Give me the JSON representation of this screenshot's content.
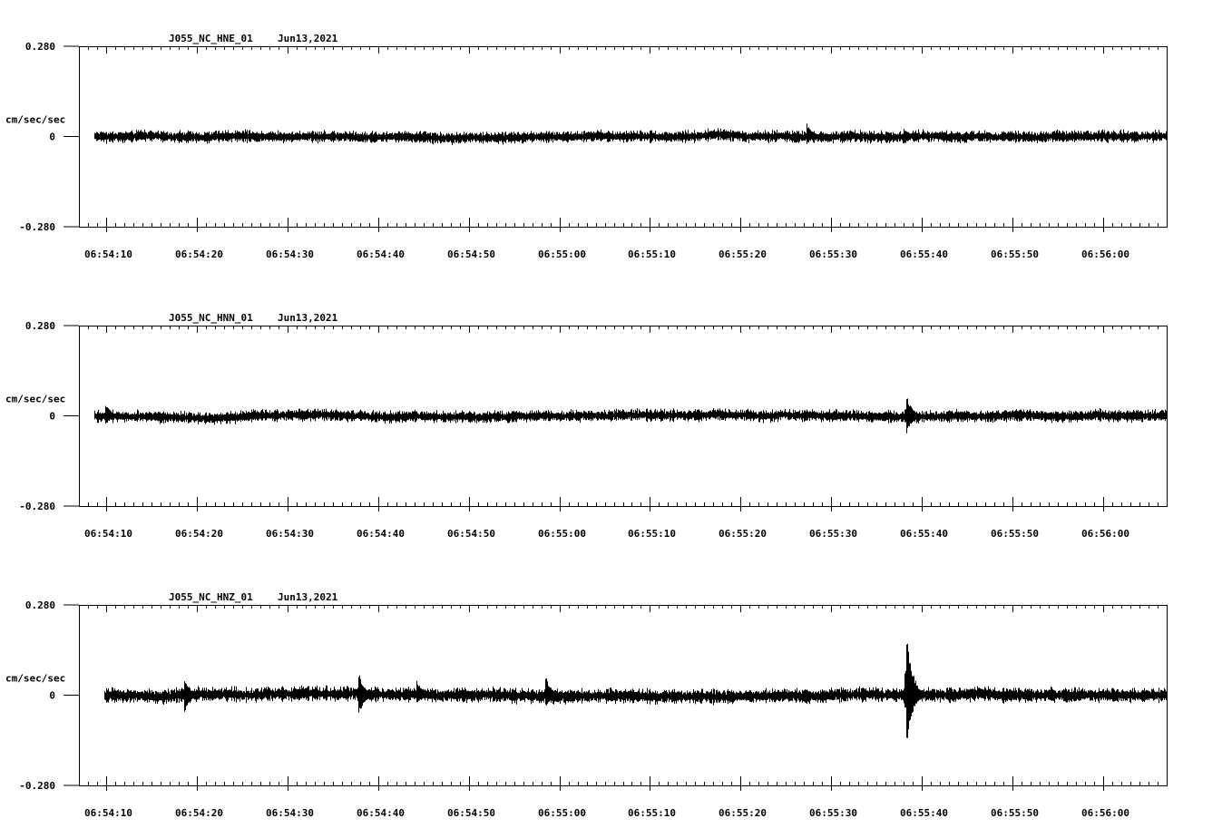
{
  "chart_data": [
    {
      "type": "line",
      "title": "J055_NC_HNE_01",
      "date": "Jun13,2021",
      "ylabel": "cm/sec/sec",
      "ylim": [
        -0.28,
        0.28
      ],
      "y_ticks": [
        "0.280",
        "0",
        "-0.280"
      ],
      "x_ticks": [
        "06:54:10",
        "06:54:20",
        "06:54:30",
        "06:54:40",
        "06:54:50",
        "06:55:00",
        "06:55:10",
        "06:55:20",
        "06:55:30",
        "06:55:40",
        "06:55:50",
        "06:56:00"
      ],
      "x_range_s": [
        7,
        127
      ],
      "signal": {
        "start_s": 8.7,
        "noise_amplitude": 0.018,
        "events": [
          {
            "t": 87.2,
            "peak_pos": 0.045,
            "peak_neg": -0.03
          },
          {
            "t": 97.9,
            "peak_pos": 0.03,
            "peak_neg": -0.03
          }
        ]
      },
      "grid": false,
      "color": "#000000"
    },
    {
      "type": "line",
      "title": "J055_NC_HNN_01",
      "date": "Jun13,2021",
      "ylabel": "cm/sec/sec",
      "ylim": [
        -0.28,
        0.28
      ],
      "y_ticks": [
        "0.280",
        "0",
        "-0.280"
      ],
      "x_ticks": [
        "06:54:10",
        "06:54:20",
        "06:54:30",
        "06:54:40",
        "06:54:50",
        "06:55:00",
        "06:55:10",
        "06:55:20",
        "06:55:30",
        "06:55:40",
        "06:55:50",
        "06:56:00"
      ],
      "x_range_s": [
        7,
        127
      ],
      "signal": {
        "start_s": 8.7,
        "noise_amplitude": 0.018,
        "events": [
          {
            "t": 98.2,
            "peak_pos": 0.075,
            "peak_neg": -0.065
          },
          {
            "t": 9.9,
            "peak_pos": 0.04,
            "peak_neg": -0.03
          }
        ]
      },
      "grid": false,
      "color": "#000000"
    },
    {
      "type": "line",
      "title": "J055_NC_HNZ_01",
      "date": "Jun13,2021",
      "ylabel": "cm/sec/sec",
      "ylim": [
        -0.28,
        0.28
      ],
      "y_ticks": [
        "0.280",
        "0",
        "-0.280"
      ],
      "x_ticks": [
        "06:54:10",
        "06:54:20",
        "06:54:30",
        "06:54:40",
        "06:54:50",
        "06:55:00",
        "06:55:10",
        "06:55:20",
        "06:55:30",
        "06:55:40",
        "06:55:50",
        "06:56:00"
      ],
      "x_range_s": [
        7,
        127
      ],
      "signal": {
        "start_s": 9.8,
        "noise_amplitude": 0.022,
        "events": [
          {
            "t": 98.2,
            "peak_pos": 0.25,
            "peak_neg": -0.18
          },
          {
            "t": 37.8,
            "peak_pos": 0.08,
            "peak_neg": -0.07
          },
          {
            "t": 18.6,
            "peak_pos": 0.06,
            "peak_neg": -0.065
          },
          {
            "t": 58.4,
            "peak_pos": 0.07,
            "peak_neg": -0.04
          },
          {
            "t": 44.2,
            "peak_pos": 0.05,
            "peak_neg": -0.03
          }
        ]
      },
      "grid": false,
      "color": "#000000"
    }
  ]
}
